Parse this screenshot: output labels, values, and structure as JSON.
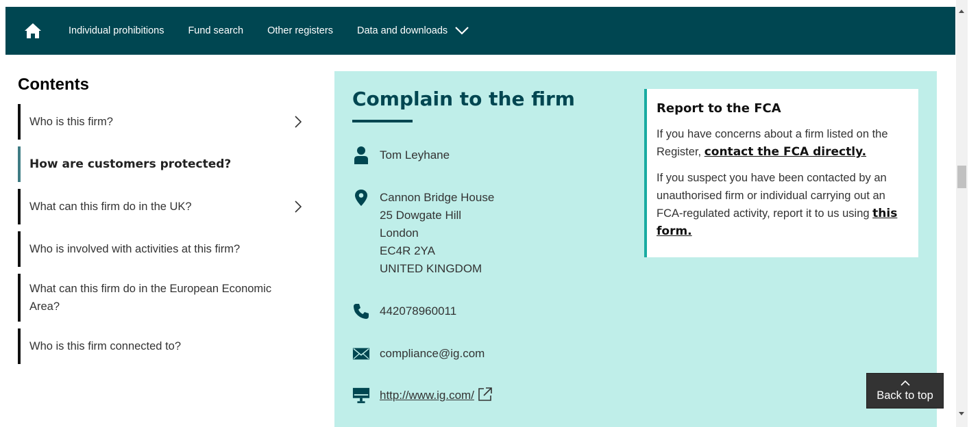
{
  "nav": {
    "links": [
      "Individual prohibitions",
      "Fund search",
      "Other registers",
      "Data and downloads"
    ]
  },
  "contents": {
    "title": "Contents",
    "items": [
      {
        "label": "Who is this firm?"
      },
      {
        "label": "How are customers protected?"
      },
      {
        "label": "What can this firm do in the UK?"
      },
      {
        "label": "Who is involved with activities at this firm?"
      },
      {
        "label": "What can this firm do in the European Economic Area?"
      },
      {
        "label": "Who is this firm connected to?"
      }
    ]
  },
  "complain": {
    "title": "Complain to the firm",
    "contact_name": "Tom Leyhane",
    "address": [
      "Cannon Bridge House",
      "25 Dowgate Hill",
      "London",
      "EC4R 2YA",
      "UNITED KINGDOM"
    ],
    "phone": "442078960011",
    "email": "compliance@ig.com",
    "website": "http://www.ig.com/"
  },
  "report": {
    "title": "Report to the FCA",
    "p1_text": "If you have concerns about a firm listed on the Register, ",
    "p1_link": "contact the FCA directly.",
    "p2_text": "If you suspect you have been contacted by an unauthorised firm or individual carrying out an FCA-regulated activity, report it to us using ",
    "p2_link": "this form."
  },
  "back_to_top": "Back to top",
  "colors": {
    "nav_bg": "#004651",
    "panel_bg": "#bfeee9",
    "accent": "#19aba1"
  }
}
